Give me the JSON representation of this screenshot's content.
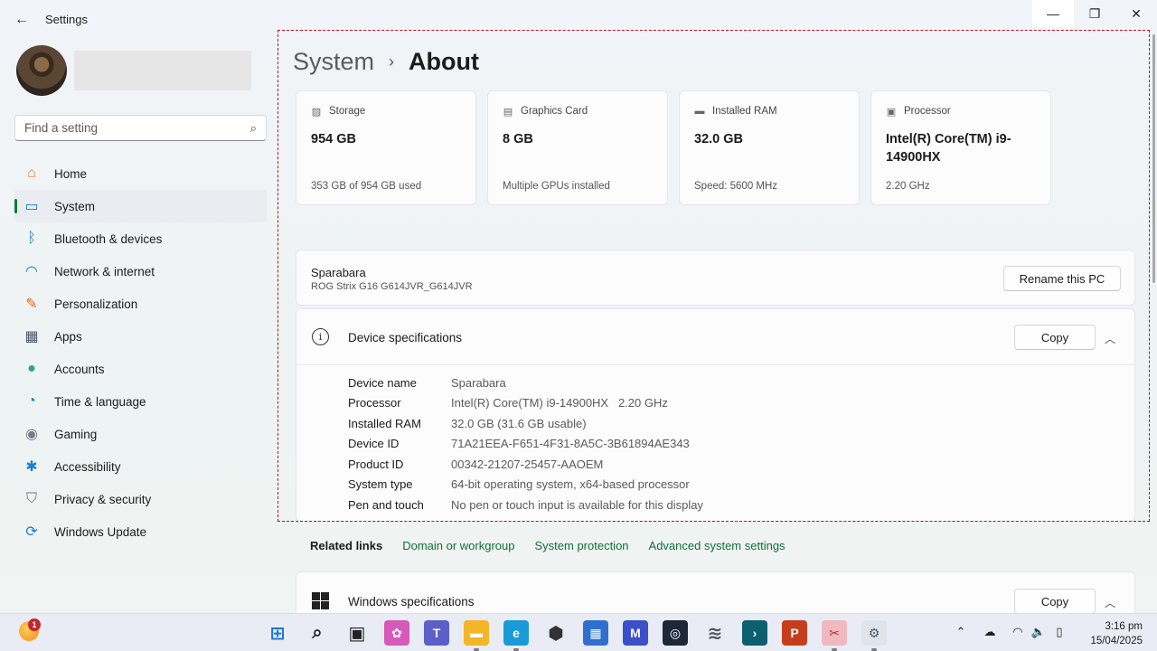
{
  "window": {
    "app_title": "Settings",
    "back_glyph": "←",
    "min_glyph": "—",
    "max_glyph": "❐",
    "close_glyph": "✕"
  },
  "search": {
    "placeholder": "Find a setting",
    "icon": "⌕"
  },
  "sidebar": {
    "items": [
      {
        "label": "Home",
        "icon": "home-icon",
        "glyph": "⌂",
        "color": "#e07b39"
      },
      {
        "label": "System",
        "icon": "system-icon",
        "glyph": "▭",
        "color": "#1b7fcc"
      },
      {
        "label": "Bluetooth & devices",
        "icon": "bluetooth-icon",
        "glyph": "ᛒ",
        "color": "#1b7fcc"
      },
      {
        "label": "Network & internet",
        "icon": "wifi-icon",
        "glyph": "◠",
        "color": "#1b7fcc"
      },
      {
        "label": "Personalization",
        "icon": "brush-icon",
        "glyph": "✎",
        "color": "#d9682a"
      },
      {
        "label": "Apps",
        "icon": "apps-icon",
        "glyph": "▦",
        "color": "#4a5a6a"
      },
      {
        "label": "Accounts",
        "icon": "accounts-icon",
        "glyph": "●",
        "color": "#2ba58a"
      },
      {
        "label": "Time & language",
        "icon": "globe-clock-icon",
        "glyph": "◔",
        "color": "#1b7fcc"
      },
      {
        "label": "Gaming",
        "icon": "gamepad-icon",
        "glyph": "◉",
        "color": "#7a7a8a"
      },
      {
        "label": "Accessibility",
        "icon": "accessibility-icon",
        "glyph": "✱",
        "color": "#1b7fcc"
      },
      {
        "label": "Privacy & security",
        "icon": "shield-icon",
        "glyph": "⛉",
        "color": "#6a7280"
      },
      {
        "label": "Windows Update",
        "icon": "update-icon",
        "glyph": "⟳",
        "color": "#1b7fcc"
      }
    ],
    "active_index": 1,
    "accent": "#0f7b3e"
  },
  "breadcrumb": {
    "parent": "System",
    "separator": "›",
    "current": "About"
  },
  "tiles": [
    {
      "title": "Storage",
      "icon": "storage-icon",
      "glyph": "▨",
      "value": "954 GB",
      "sub": "353 GB of 954 GB used"
    },
    {
      "title": "Graphics Card",
      "icon": "graphics-card-icon",
      "glyph": "▤",
      "value": "8 GB",
      "sub": "Multiple GPUs installed"
    },
    {
      "title": "Installed RAM",
      "icon": "ram-icon",
      "glyph": "▬",
      "value": "32.0 GB",
      "sub": "Speed: 5600 MHz"
    },
    {
      "title": "Processor",
      "icon": "processor-icon",
      "glyph": "▣",
      "value": "Intel(R) Core(TM) i9-14900HX",
      "sub": "2.20 GHz"
    }
  ],
  "pc": {
    "name": "Sparabara",
    "model": "ROG Strix G16 G614JVR_G614JVR",
    "rename_label": "Rename this PC"
  },
  "device_specs": {
    "title": "Device specifications",
    "info_glyph": "i",
    "copy_label": "Copy",
    "chevron": "︿",
    "rows": [
      {
        "key": "Device name",
        "value": "Sparabara"
      },
      {
        "key": "Processor",
        "value": "Intel(R) Core(TM) i9-14900HX   2.20 GHz"
      },
      {
        "key": "Installed RAM",
        "value": "32.0 GB (31.6 GB usable)"
      },
      {
        "key": "Device ID",
        "value": "71A21EEA-F651-4F31-8A5C-3B61894AE343"
      },
      {
        "key": "Product ID",
        "value": "00342-21207-25457-AAOEM"
      },
      {
        "key": "System type",
        "value": "64-bit operating system, x64-based processor"
      },
      {
        "key": "Pen and touch",
        "value": "No pen or touch input is available for this display"
      }
    ]
  },
  "related_links": {
    "label": "Related links",
    "links": [
      "Domain or workgroup",
      "System protection",
      "Advanced system settings"
    ],
    "link_color": "#0f6e3a"
  },
  "windows_specs": {
    "title": "Windows specifications",
    "copy_label": "Copy",
    "chevron": "︿"
  },
  "taskbar": {
    "weather_badge": "1",
    "apps": [
      {
        "name": "start-button",
        "glyph": "⊞",
        "bg": "transparent",
        "fg": "#1a73d9"
      },
      {
        "name": "search-taskbar-icon",
        "glyph": "⌕",
        "bg": "transparent",
        "fg": "#222"
      },
      {
        "name": "task-view-icon",
        "glyph": "▣",
        "bg": "transparent",
        "fg": "#222"
      },
      {
        "name": "copilot-icon",
        "glyph": "✿",
        "bg": "#d65ab8",
        "fg": "#fff"
      },
      {
        "name": "teams-icon",
        "glyph": "T",
        "bg": "#5b5fc7",
        "fg": "#fff"
      },
      {
        "name": "file-explorer-icon",
        "glyph": "▬",
        "bg": "#f2b628",
        "fg": "#fff"
      },
      {
        "name": "edge-icon",
        "glyph": "e",
        "bg": "#1a9ad6",
        "fg": "#fff"
      },
      {
        "name": "app-hexagon-icon",
        "glyph": "⬢",
        "bg": "transparent",
        "fg": "#333"
      },
      {
        "name": "store-icon",
        "glyph": "▦",
        "bg": "#2f6fd0",
        "fg": "#fff"
      },
      {
        "name": "app-m-icon",
        "glyph": "M",
        "bg": "#3b4fc8",
        "fg": "#fff"
      },
      {
        "name": "steam-icon",
        "glyph": "◎",
        "bg": "#1b2838",
        "fg": "#fff"
      },
      {
        "name": "app-wing-icon",
        "glyph": "≋",
        "bg": "transparent",
        "fg": "#555"
      },
      {
        "name": "app-terminal-icon",
        "glyph": "›",
        "bg": "#0b5f6e",
        "fg": "#fff"
      },
      {
        "name": "powerpoint-icon",
        "glyph": "P",
        "bg": "#c43e1c",
        "fg": "#fff"
      },
      {
        "name": "snipping-tool-icon",
        "glyph": "✂",
        "bg": "#f0b8bf",
        "fg": "#c4262e"
      },
      {
        "name": "settings-icon",
        "glyph": "⚙",
        "bg": "#dfe3ea",
        "fg": "#4a5568"
      }
    ],
    "tray": [
      {
        "name": "show-hidden-icons",
        "glyph": "⌃"
      },
      {
        "name": "onedrive-icon",
        "glyph": "☁"
      },
      {
        "name": "wifi-tray-icon",
        "glyph": "◠"
      },
      {
        "name": "volume-icon",
        "glyph": "🔈"
      },
      {
        "name": "battery-icon",
        "glyph": "▯"
      }
    ],
    "time": "3:16 pm",
    "date": "15/04/2025"
  }
}
